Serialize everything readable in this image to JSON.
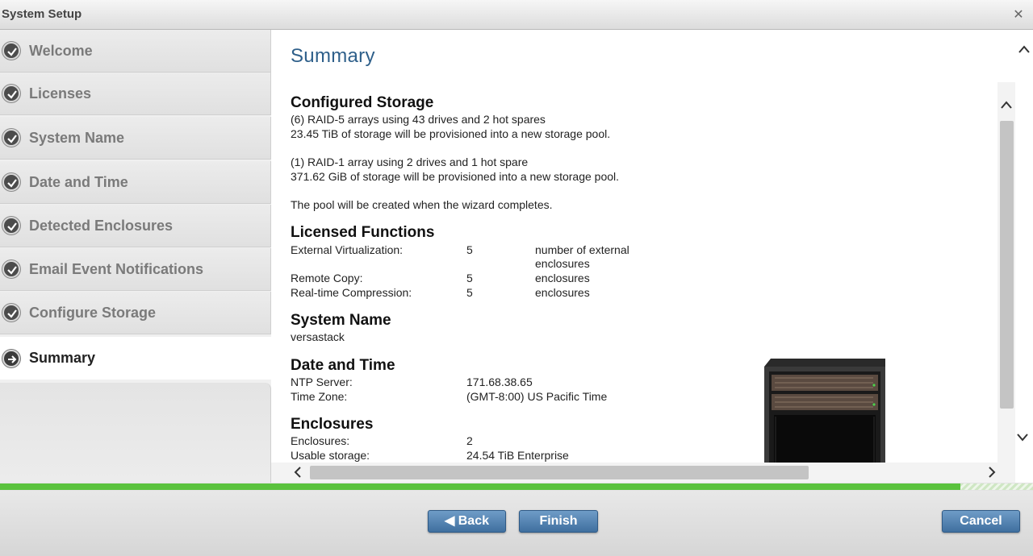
{
  "window": {
    "title": "System Setup",
    "close_icon": "close-icon"
  },
  "sidebar": {
    "items": [
      {
        "label": "Welcome",
        "status": "complete"
      },
      {
        "label": "Licenses",
        "status": "complete"
      },
      {
        "label": "System Name",
        "status": "complete"
      },
      {
        "label": "Date and Time",
        "status": "complete"
      },
      {
        "label": "Detected Enclosures",
        "status": "complete"
      },
      {
        "label": "Email Event Notifications",
        "status": "complete"
      },
      {
        "label": "Configure Storage",
        "status": "complete"
      },
      {
        "label": "Summary",
        "status": "current"
      }
    ]
  },
  "main": {
    "heading": "Summary",
    "configured_storage": {
      "title": "Configured Storage",
      "line1": "(6) RAID-5 arrays using 43 drives and 2 hot spares",
      "line2": "23.45 TiB of storage will be provisioned into a new storage pool.",
      "line3": "(1) RAID-1 array using 2 drives and 1 hot spare",
      "line4": "371.62 GiB of storage will be provisioned into a new storage pool.",
      "line5": "The pool will be created when the wizard completes."
    },
    "licensed_functions": {
      "title": "Licensed Functions",
      "rows": [
        {
          "name": "External Virtualization:",
          "value": "5",
          "unit": "number of external",
          "unit2": "enclosures"
        },
        {
          "name": "Remote Copy:",
          "value": "5",
          "unit": "enclosures"
        },
        {
          "name": "Real-time Compression:",
          "value": "5",
          "unit": "enclosures"
        }
      ]
    },
    "system_name": {
      "title": "System Name",
      "value": "versastack"
    },
    "date_time": {
      "title": "Date and Time",
      "ntp_label": "NTP Server:",
      "ntp_value": "171.68.38.65",
      "tz_label": "Time Zone:",
      "tz_value": "(GMT-8:00) US Pacific Time"
    },
    "enclosures": {
      "title": "Enclosures",
      "enc_label": "Enclosures:",
      "enc_value": "2",
      "usable_label": "Usable storage:",
      "usable_value": "24.54 TiB Enterprise"
    }
  },
  "progress": {
    "fraction": 0.93,
    "fill_color": "#5ac23d"
  },
  "footer": {
    "back_label": "◀ Back",
    "finish_label": "Finish",
    "cancel_label": "Cancel"
  },
  "colors": {
    "button": "#4a7aa8",
    "heading": "#2e5f8a"
  }
}
